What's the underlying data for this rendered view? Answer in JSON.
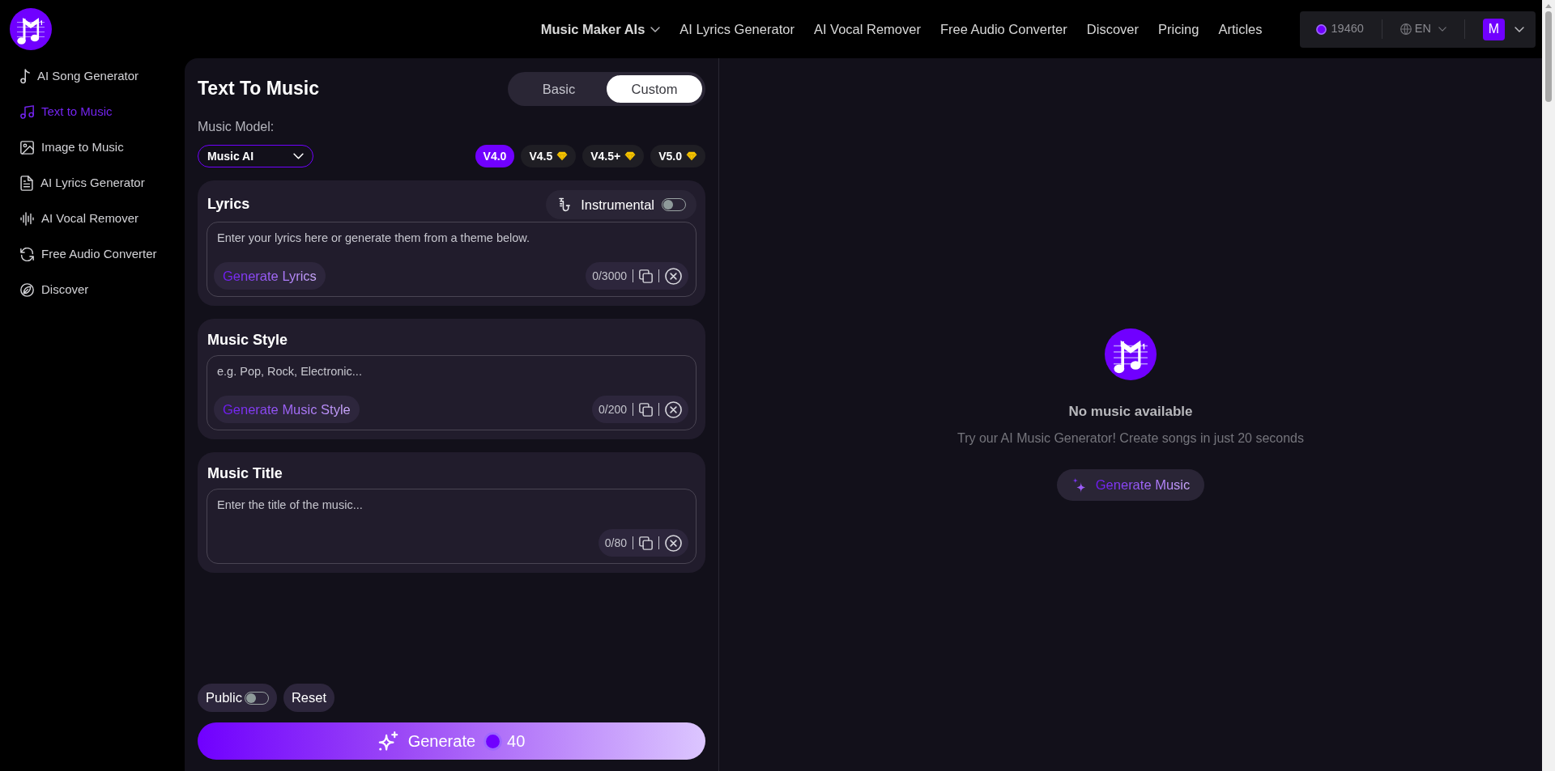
{
  "header": {
    "nav": [
      {
        "label": "Music Maker AIs",
        "kind": "dropdown"
      },
      {
        "label": "AI Lyrics Generator",
        "kind": "link"
      },
      {
        "label": "AI Vocal Remover",
        "kind": "link"
      },
      {
        "label": "Free Audio Converter",
        "kind": "link"
      },
      {
        "label": "Discover",
        "kind": "link"
      },
      {
        "label": "Pricing",
        "kind": "link"
      },
      {
        "label": "Articles",
        "kind": "link"
      }
    ],
    "account": {
      "credits": "19460",
      "language": "EN",
      "avatar": "M"
    }
  },
  "sidebar": {
    "items": [
      {
        "label": "AI Song Generator",
        "selected": false
      },
      {
        "label": "Text to Music",
        "selected": true
      },
      {
        "label": "Image to Music",
        "selected": false
      },
      {
        "label": "AI Lyrics Generator",
        "selected": false
      },
      {
        "label": "AI Vocal Remover",
        "selected": false
      },
      {
        "label": "Free Audio Converter",
        "selected": false
      },
      {
        "label": "Discover",
        "selected": false
      }
    ]
  },
  "generator": {
    "title": "Text To Music",
    "modes": [
      {
        "label": "Basic",
        "selected": false
      },
      {
        "label": "Custom",
        "selected": true
      }
    ],
    "model_label": "Music Model:",
    "model_select": "Music AI",
    "versions": [
      {
        "label": "V4.0",
        "selected": true,
        "premium": false
      },
      {
        "label": "V4.5",
        "selected": false,
        "premium": true
      },
      {
        "label": "V4.5+",
        "selected": false,
        "premium": true
      },
      {
        "label": "V5.0",
        "selected": false,
        "premium": true
      }
    ],
    "sections": [
      {
        "title": "Lyrics",
        "placeholder": "Enter your lyrics here or generate them from a theme below.",
        "action": "Generate Lyrics",
        "counter": "0/3000",
        "instrumental": {
          "label": "Instrumental",
          "on": false
        }
      },
      {
        "title": "Music Style",
        "placeholder": "e.g. Pop, Rock, Electronic...",
        "action": "Generate Music Style",
        "counter": "0/200"
      },
      {
        "title": "Music Title",
        "placeholder": "Enter the title of the music...",
        "counter": "0/80"
      }
    ],
    "public": {
      "label": "Public",
      "on": false
    },
    "reset": "Reset",
    "generate": {
      "label": "Generate",
      "cost": "40"
    }
  },
  "results": {
    "empty_title": "No music available",
    "empty_text": "Try our AI Music Generator! Create songs in just 20 seconds",
    "action": "Generate Music"
  }
}
